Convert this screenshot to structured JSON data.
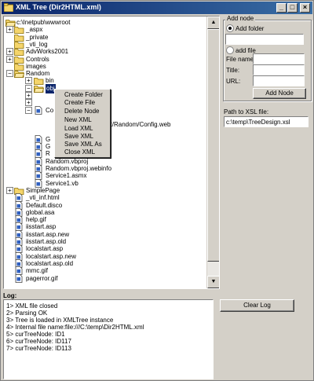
{
  "window": {
    "title": "XML Tree (Dir2HTML.xml)",
    "minimize": "_",
    "maximize": "□",
    "close": "×"
  },
  "tree": {
    "root": "c:\\Inetpub\\wwwroot",
    "items": [
      {
        "label": "_aspx",
        "kind": "folder",
        "level": 1,
        "expander": "+"
      },
      {
        "label": "_private",
        "kind": "folder",
        "level": 1,
        "expander": ""
      },
      {
        "label": "_vti_log",
        "kind": "folder",
        "level": 1,
        "expander": ""
      },
      {
        "label": "AdvWorks2001",
        "kind": "folder",
        "level": 1,
        "expander": "+"
      },
      {
        "label": "Controls",
        "kind": "folder",
        "level": 1,
        "expander": "+"
      },
      {
        "label": "images",
        "kind": "folder",
        "level": 1,
        "expander": ""
      },
      {
        "label": "Random",
        "kind": "folder-open",
        "level": 1,
        "expander": "−"
      },
      {
        "label": "bin",
        "kind": "folder",
        "level": 2,
        "expander": "+"
      },
      {
        "label": "obj",
        "kind": "folder-open",
        "level": 2,
        "expander": "−",
        "selected": true
      },
      {
        "label": "",
        "kind": "blank",
        "level": 2,
        "expander": "+"
      },
      {
        "label": "",
        "kind": "blank",
        "level": 2,
        "expander": "+"
      },
      {
        "label": "Co",
        "kind": "file",
        "level": 2,
        "expander": "−"
      },
      {
        "label": "",
        "kind": "blank",
        "level": 3,
        "expander": ""
      },
      {
        "label": "root/Random/Config.web",
        "kind": "text",
        "level": 3,
        "expander": ""
      },
      {
        "label": "",
        "kind": "blank",
        "level": 2,
        "expander": ""
      },
      {
        "label": "G",
        "kind": "file",
        "level": 2,
        "expander": ""
      },
      {
        "label": "G",
        "kind": "file",
        "level": 2,
        "expander": ""
      },
      {
        "label": "R",
        "kind": "file",
        "level": 2,
        "expander": ""
      },
      {
        "label": "Random.vbproj",
        "kind": "file",
        "level": 2,
        "expander": ""
      },
      {
        "label": "Random.vbproj.webinfo",
        "kind": "file",
        "level": 2,
        "expander": ""
      },
      {
        "label": "Service1.asmx",
        "kind": "file",
        "level": 2,
        "expander": ""
      },
      {
        "label": "Service1.vb",
        "kind": "file",
        "level": 2,
        "expander": ""
      },
      {
        "label": "SimplePage",
        "kind": "folder",
        "level": 1,
        "expander": "+"
      },
      {
        "label": "_vti_inf.html",
        "kind": "file",
        "level": 1,
        "expander": ""
      },
      {
        "label": "Default.disco",
        "kind": "file",
        "level": 1,
        "expander": ""
      },
      {
        "label": "global.asa",
        "kind": "file",
        "level": 1,
        "expander": ""
      },
      {
        "label": "help.gif",
        "kind": "file",
        "level": 1,
        "expander": ""
      },
      {
        "label": "iisstart.asp",
        "kind": "file",
        "level": 1,
        "expander": ""
      },
      {
        "label": "iisstart.asp.new",
        "kind": "file",
        "level": 1,
        "expander": ""
      },
      {
        "label": "iisstart.asp.old",
        "kind": "file",
        "level": 1,
        "expander": ""
      },
      {
        "label": "localstart.asp",
        "kind": "file",
        "level": 1,
        "expander": ""
      },
      {
        "label": "localstart.asp.new",
        "kind": "file",
        "level": 1,
        "expander": ""
      },
      {
        "label": "localstart.asp.old",
        "kind": "file",
        "level": 1,
        "expander": ""
      },
      {
        "label": "mmc.gif",
        "kind": "file",
        "level": 1,
        "expander": ""
      },
      {
        "label": "pagerror.gif",
        "kind": "file",
        "level": 1,
        "expander": ""
      }
    ]
  },
  "context_menu": {
    "items": [
      "Create Folder",
      "Create File",
      "Delete Node",
      "New XML",
      "Load XML",
      "Save XML",
      "Save XML As",
      "Close XML"
    ]
  },
  "add_node": {
    "legend": "Add node",
    "add_folder_label": "Add folder",
    "add_file_label": "add file",
    "folder_value": "",
    "file_name_label": "File name:",
    "file_name_value": "",
    "title_label": "Title:",
    "title_value": "",
    "url_label": "URL:",
    "url_value": "",
    "add_node_button": "Add Node",
    "selected_option": "Add folder"
  },
  "xsl": {
    "label": "Path to XSL file:",
    "value": "c:\\temp\\TreeDesign.xsl"
  },
  "log": {
    "title": "Log:",
    "clear_button": "Clear Log",
    "lines": [
      "1> XML file closed",
      "2> Parsing OK",
      "3> Tree is loaded in XMLTree instance",
      "4> Internal file name:file:///C:\\temp\\Dir2HTML.xml",
      "5> curTreeNode: ID1",
      "6> curTreeNode: ID117",
      "7> curTreeNode: ID113"
    ]
  },
  "colors": {
    "titlebar_start": "#0a246a",
    "titlebar_end": "#3a6ea5",
    "selection": "#0a246a",
    "face": "#d4d0c8",
    "folder": "#f5d56b"
  }
}
